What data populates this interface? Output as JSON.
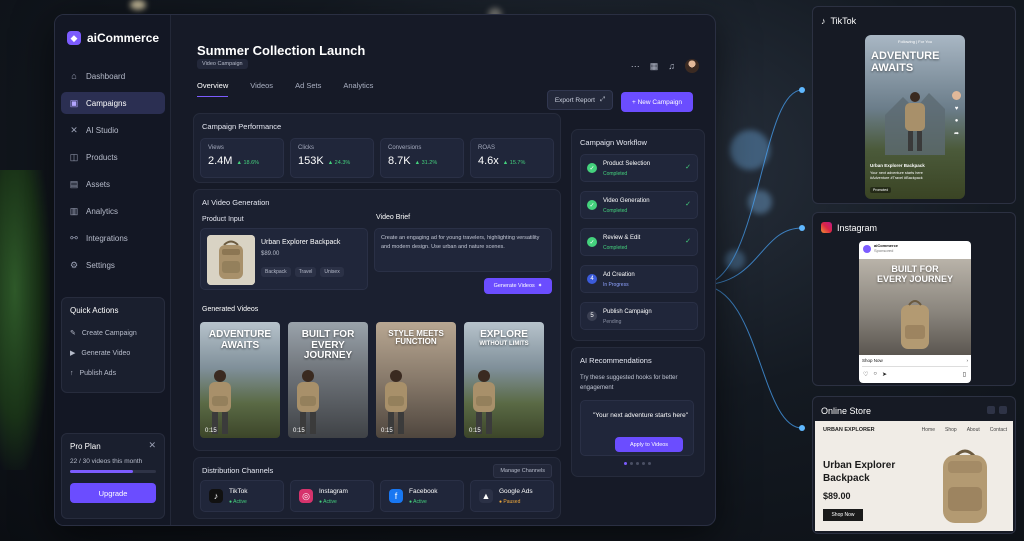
{
  "app": {
    "brand": "aiCommerce",
    "page_title": "Summer Collection Launch",
    "page_badge": "Video Campaign"
  },
  "sidebar": {
    "items": [
      {
        "label": "Dashboard",
        "icon": "home-icon",
        "glyph": "⌂"
      },
      {
        "label": "Campaigns",
        "icon": "campaign-icon",
        "glyph": "▣"
      },
      {
        "label": "AI Studio",
        "icon": "sparkle-icon",
        "glyph": "✕"
      },
      {
        "label": "Products",
        "icon": "box-icon",
        "glyph": "◫"
      },
      {
        "label": "Assets",
        "icon": "image-icon",
        "glyph": "▤"
      },
      {
        "label": "Analytics",
        "icon": "chart-icon",
        "glyph": "▥"
      },
      {
        "label": "Integrations",
        "icon": "link-icon",
        "glyph": "⚯"
      },
      {
        "label": "Settings",
        "icon": "gear-icon",
        "glyph": "⚙"
      }
    ],
    "quick_actions": {
      "title": "Quick Actions",
      "items": [
        {
          "label": "Create Campaign",
          "glyph": "✎"
        },
        {
          "label": "Generate Video",
          "glyph": "▶"
        },
        {
          "label": "Publish Ads",
          "glyph": "↑"
        }
      ]
    },
    "pro_plan": {
      "title": "Pro Plan",
      "usage_text": "22 / 30 videos this month",
      "usage_fraction": 0.733,
      "upgrade_label": "Upgrade"
    }
  },
  "tabs": [
    {
      "label": "Overview",
      "active": true
    },
    {
      "label": "Videos",
      "active": false
    },
    {
      "label": "Ad Sets",
      "active": false
    },
    {
      "label": "Analytics",
      "active": false
    }
  ],
  "toolbar": {
    "export_label": "Export Report",
    "new_campaign_label": "+ New Campaign"
  },
  "performance": {
    "title": "Campaign Performance",
    "metrics": [
      {
        "label": "Views",
        "value": "2.4M",
        "change": "▲ 18.6%"
      },
      {
        "label": "Clicks",
        "value": "153K",
        "change": "▲ 24.3%"
      },
      {
        "label": "Conversions",
        "value": "8.7K",
        "change": "▲ 31.2%"
      },
      {
        "label": "ROAS",
        "value": "4.6x",
        "change": "▲ 15.7%"
      }
    ]
  },
  "ai_video": {
    "title": "AI Video Generation",
    "product_input_label": "Product Input",
    "product_name": "Urban Explorer Backpack",
    "product_price": "$89.00",
    "tags": [
      "Backpack",
      "Travel",
      "Unisex"
    ],
    "brief_label": "Video Brief",
    "brief_text": "Create an engaging ad for young travelers, highlighting versatility and modern design. Use urban and nature scenes.",
    "generate_label": "Generate Videos",
    "generated_label": "Generated Videos",
    "videos": [
      {
        "line1": "ADVENTURE",
        "line2": "AWAITS",
        "sub": "",
        "time": "0:15",
        "scene": "mountain"
      },
      {
        "line1": "BUILT FOR",
        "line2": "EVERY JOURNEY",
        "sub": "",
        "time": "0:15",
        "scene": "city"
      },
      {
        "line1": "STYLE MEETS",
        "line2": "FUNCTION",
        "sub": "",
        "time": "0:15",
        "scene": "street"
      },
      {
        "line1": "EXPLORE",
        "line2": "",
        "sub": "WITHOUT LIMITS",
        "time": "0:15",
        "scene": "mountain"
      }
    ]
  },
  "distribution": {
    "title": "Distribution Channels",
    "manage_label": "Manage Channels",
    "channels": [
      {
        "name": "TikTok",
        "status": "● Active",
        "status_color": "#44d27d",
        "glyph": "♪",
        "bg": "#111111"
      },
      {
        "name": "Instagram",
        "status": "● Active",
        "status_color": "#44d27d",
        "glyph": "◎",
        "bg": "#d6336c"
      },
      {
        "name": "Facebook",
        "status": "● Active",
        "status_color": "#44d27d",
        "glyph": "f",
        "bg": "#1877f2"
      },
      {
        "name": "Google Ads",
        "status": "● Paused",
        "status_color": "#f0a93b",
        "glyph": "▲",
        "bg": "#2b3146"
      }
    ]
  },
  "workflow": {
    "title": "Campaign Workflow",
    "steps": [
      {
        "name": "Product Selection",
        "status": "Completed",
        "state": "done",
        "num": "✓"
      },
      {
        "name": "Video Generation",
        "status": "Completed",
        "state": "done",
        "num": "✓"
      },
      {
        "name": "Review & Edit",
        "status": "Completed",
        "state": "done",
        "num": "✓"
      },
      {
        "name": "Ad Creation",
        "status": "In Progress",
        "state": "progress",
        "num": "4"
      },
      {
        "name": "Publish Campaign",
        "status": "Pending",
        "state": "pending",
        "num": "5"
      }
    ]
  },
  "recommendations": {
    "title": "AI Recommendations",
    "text": "Try these suggested hooks for better engagement",
    "quote": "\"Your next adventure starts here\"",
    "apply_label": "Apply to Videos"
  },
  "previews": {
    "tiktok": {
      "title": "TikTok",
      "tabs": "Following | For You",
      "headline1": "ADVENTURE",
      "headline2": "AWAITS",
      "caption_title": "Urban Explorer Backpack",
      "caption": "Your next adventure starts here #Adventure #Travel #Backpack",
      "promo": "Promoted"
    },
    "instagram": {
      "title": "Instagram",
      "account": "aiCommerce",
      "sponsored": "Sponsored",
      "headline1": "BUILT FOR",
      "headline2": "EVERY JOURNEY",
      "cta": "Shop Now"
    },
    "store": {
      "title": "Online Store",
      "brand": "URBAN EXPLORER",
      "nav": [
        "Home",
        "Shop",
        "About",
        "Contact"
      ],
      "product_line1": "Urban Explorer",
      "product_line2": "Backpack",
      "price": "$89.00",
      "cta": "Shop Now"
    }
  },
  "colors": {
    "accent": "#6b4dff",
    "success": "#44d27d",
    "warning": "#f0a93b"
  }
}
